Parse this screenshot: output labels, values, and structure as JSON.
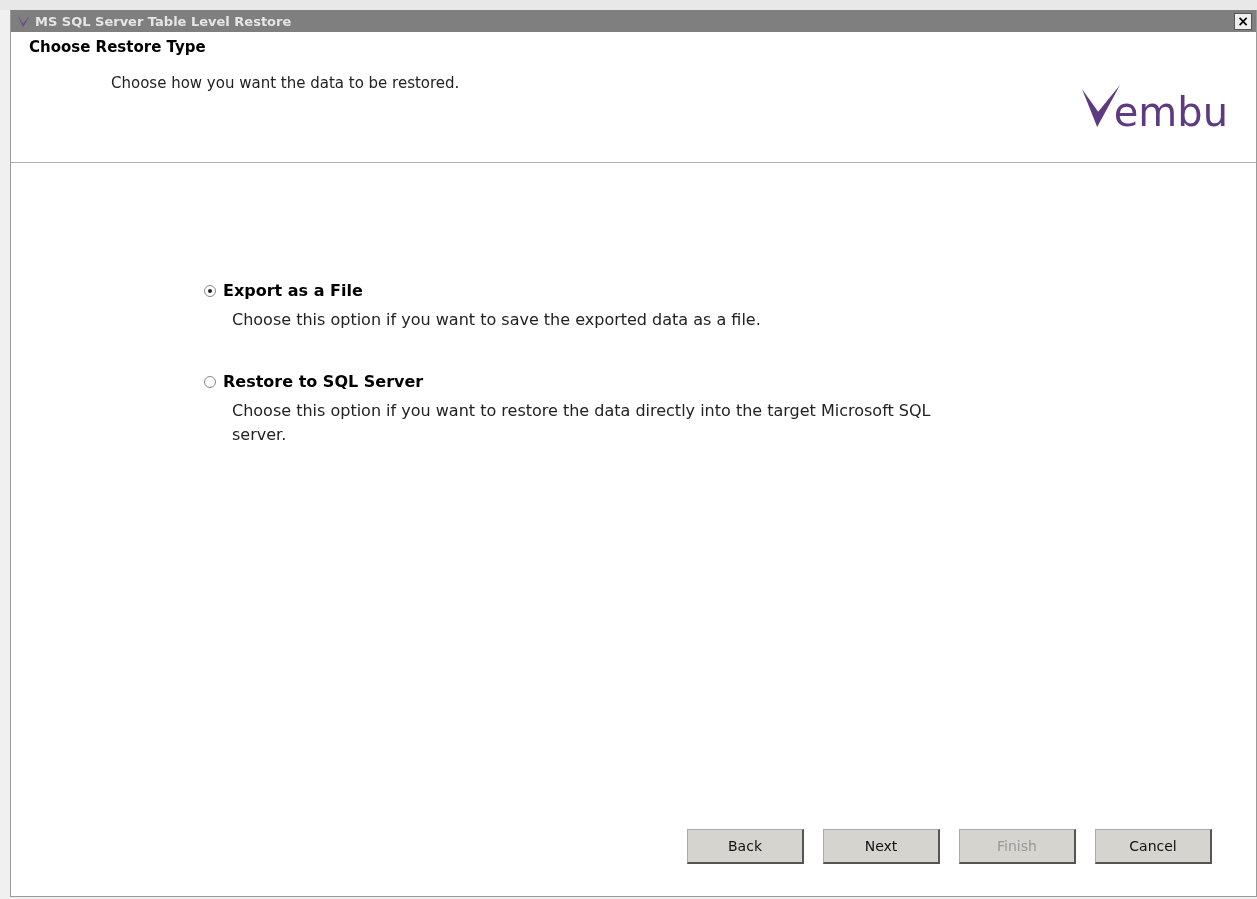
{
  "window": {
    "title": "MS SQL Server Table Level Restore",
    "close": "×"
  },
  "header": {
    "title": "Choose Restore Type",
    "subtitle": "Choose how you want the data to be restored.",
    "logo_text": "embu"
  },
  "options": [
    {
      "label": "Export as a File",
      "description": "Choose this option if you want to save the exported data as a file.",
      "selected": true
    },
    {
      "label": "Restore to SQL Server",
      "description": "Choose this option if you want to restore the data directly into the target Microsoft SQL server.",
      "selected": false
    }
  ],
  "buttons": [
    {
      "label": "Back",
      "disabled": false
    },
    {
      "label": "Next",
      "disabled": false
    },
    {
      "label": "Finish",
      "disabled": true
    },
    {
      "label": "Cancel",
      "disabled": false
    }
  ]
}
